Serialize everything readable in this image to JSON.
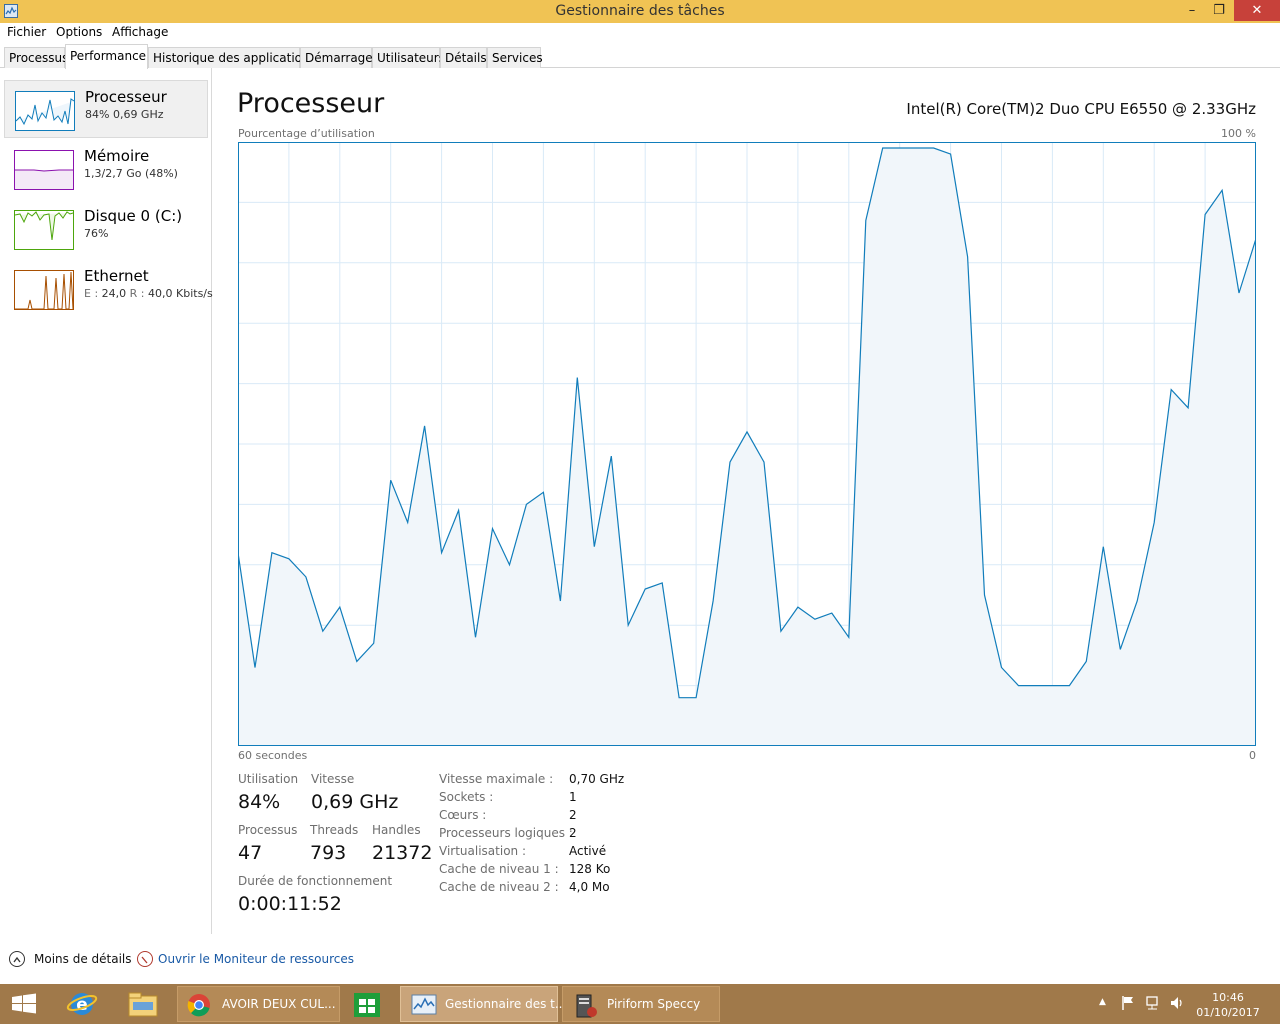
{
  "window": {
    "title": "Gestionnaire des tâches"
  },
  "menu": [
    "Fichier",
    "Options",
    "Affichage"
  ],
  "tabs": [
    "Processus",
    "Performance",
    "Historique des applications",
    "Démarrage",
    "Utilisateurs",
    "Détails",
    "Services"
  ],
  "active_tab": "Performance",
  "resources": [
    {
      "name": "Processeur",
      "sub": "84% 0,69 GHz",
      "color": "#117dbb"
    },
    {
      "name": "Mémoire",
      "sub": "1,3/2,7 Go (48%)",
      "color": "#8b12ae"
    },
    {
      "name": "Disque 0 (C:)",
      "sub": "76%",
      "color": "#4da60c"
    },
    {
      "name": "Ethernet",
      "sub_prefix_1": "E :",
      "sub_value_1": "24,0",
      "sub_prefix_2": "R :",
      "sub_value_2": "40,0 Kbits/s",
      "color": "#a74f01"
    }
  ],
  "main": {
    "title": "Processeur",
    "cpu_name": "Intel(R) Core(TM)2 Duo CPU E6550 @ 2.33GHz",
    "graph_label": "Pourcentage d’utilisation",
    "graph_max": "100 %",
    "graph_time": "60 secondes",
    "graph_min": "0"
  },
  "chart_data": {
    "type": "area",
    "title": "",
    "ylabel": "Pourcentage d’utilisation",
    "xlabel": "60 secondes",
    "ylim": [
      0,
      100
    ],
    "xlim": [
      60,
      0
    ],
    "grid": true,
    "series": [
      {
        "values": [
          32,
          13,
          32,
          31,
          28,
          19,
          23,
          14,
          17,
          44,
          37,
          53,
          32,
          39,
          18,
          36,
          30,
          40,
          42,
          24,
          61,
          33,
          48,
          20,
          26,
          27,
          8,
          8,
          24,
          47,
          52,
          47,
          19,
          23,
          21,
          22,
          18,
          87,
          99,
          99,
          99,
          99,
          98,
          81,
          25,
          13,
          10,
          10,
          10,
          10,
          14,
          33,
          16,
          24,
          37,
          59,
          56,
          88,
          92,
          75,
          84
        ]
      }
    ]
  },
  "stats": {
    "utilisation_label": "Utilisation",
    "utilisation": "84%",
    "vitesse_label": "Vitesse",
    "vitesse": "0,69 GHz",
    "processus_label": "Processus",
    "processus": "47",
    "threads_label": "Threads",
    "threads": "793",
    "handles_label": "Handles",
    "handles": "21372",
    "uptime_label": "Durée de fonctionnement",
    "uptime": "0:00:11:52"
  },
  "details": [
    {
      "label": "Vitesse maximale :",
      "value": "0,70 GHz"
    },
    {
      "label": "Sockets :",
      "value": "1"
    },
    {
      "label": "Cœurs :",
      "value": "2"
    },
    {
      "label": "Processeurs logiques :",
      "value": "2"
    },
    {
      "label": "Virtualisation :",
      "value": "Activé"
    },
    {
      "label": "Cache de niveau 1 :",
      "value": "128 Ko"
    },
    {
      "label": "Cache de niveau 2 :",
      "value": "4,0 Mo"
    }
  ],
  "footer": {
    "less_details": "Moins de détails",
    "resource_monitor": "Ouvrir le Moniteur de ressources"
  },
  "taskbar": {
    "apps": [
      {
        "label": "AVOIR DEUX CUL..."
      },
      {
        "label": "Gestionnaire des t..."
      },
      {
        "label": "Piriform Speccy"
      }
    ],
    "time": "10:46",
    "date": "01/10/2017"
  }
}
